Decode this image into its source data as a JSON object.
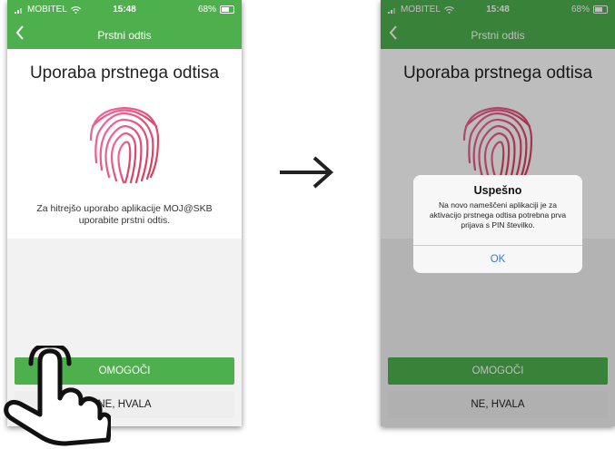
{
  "screens": [
    {
      "status": {
        "carrier": "MOBITEL",
        "time": "15:48",
        "battery": "68%"
      },
      "nav": {
        "title": "Prstni odtis"
      },
      "heading": "Uporaba prstnega odtisa",
      "description": "Za hitrejšo uporabo aplikacije MOJ@SKB uporabite prstni odtis.",
      "buttons": {
        "enable": "OMOGOČI",
        "decline": "NE, HVALA"
      }
    },
    {
      "status": {
        "carrier": "MOBITEL",
        "time": "15:48",
        "battery": "68%"
      },
      "nav": {
        "title": "Prstni odtis"
      },
      "heading": "Uporaba prstnega odtisa",
      "buttons": {
        "enable": "OMOGOČI",
        "decline": "NE, HVALA"
      },
      "alert": {
        "title": "Uspešno",
        "message": "Na novo nameščeni aplikaciji je za aktivacijo prstnega odtisa potrebna prva prijava s PIN številko.",
        "ok": "OK"
      }
    }
  ],
  "colors": {
    "brand_green": "#4eb04d",
    "alert_link": "#2f7de1"
  },
  "icons": [
    "fingerprint-icon",
    "back-chevron-icon",
    "arrow-right-icon",
    "tap-hand-icon",
    "wifi-icon",
    "battery-icon",
    "signal-icon"
  ]
}
